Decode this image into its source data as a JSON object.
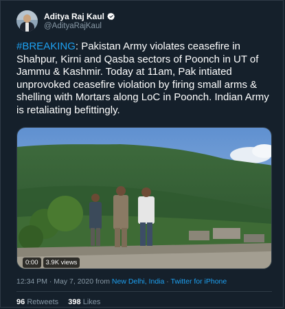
{
  "author": {
    "display_name": "Aditya Raj Kaul",
    "handle": "@AdityaRajKaul",
    "verified": true
  },
  "tweet": {
    "hashtag": "#BREAKING",
    "text": ": Pakistan Army violates ceasefire in Shahpur, Kirni and Qasba sectors of Poonch in UT of Jammu & Kashmir. Today at 11am, Pak intiated unprovoked ceasefire violation by firing small arms & shelling with Mortars along LoC in Poonch. Indian Army is retaliating befittingly."
  },
  "video": {
    "duration": "0:00",
    "views": "3.9K views"
  },
  "meta": {
    "time_date": "12:34 PM · May 7, 2020",
    "from_prefix": "from",
    "location": "New Delhi, India",
    "separator": "·",
    "source": "Twitter for iPhone"
  },
  "stats": {
    "retweets_count": "96",
    "retweets_label": "Retweets",
    "likes_count": "398",
    "likes_label": "Likes"
  },
  "colors": {
    "background": "#15202b",
    "accent": "#1da1f2",
    "muted": "#8899a6",
    "border": "#2f3b47"
  }
}
